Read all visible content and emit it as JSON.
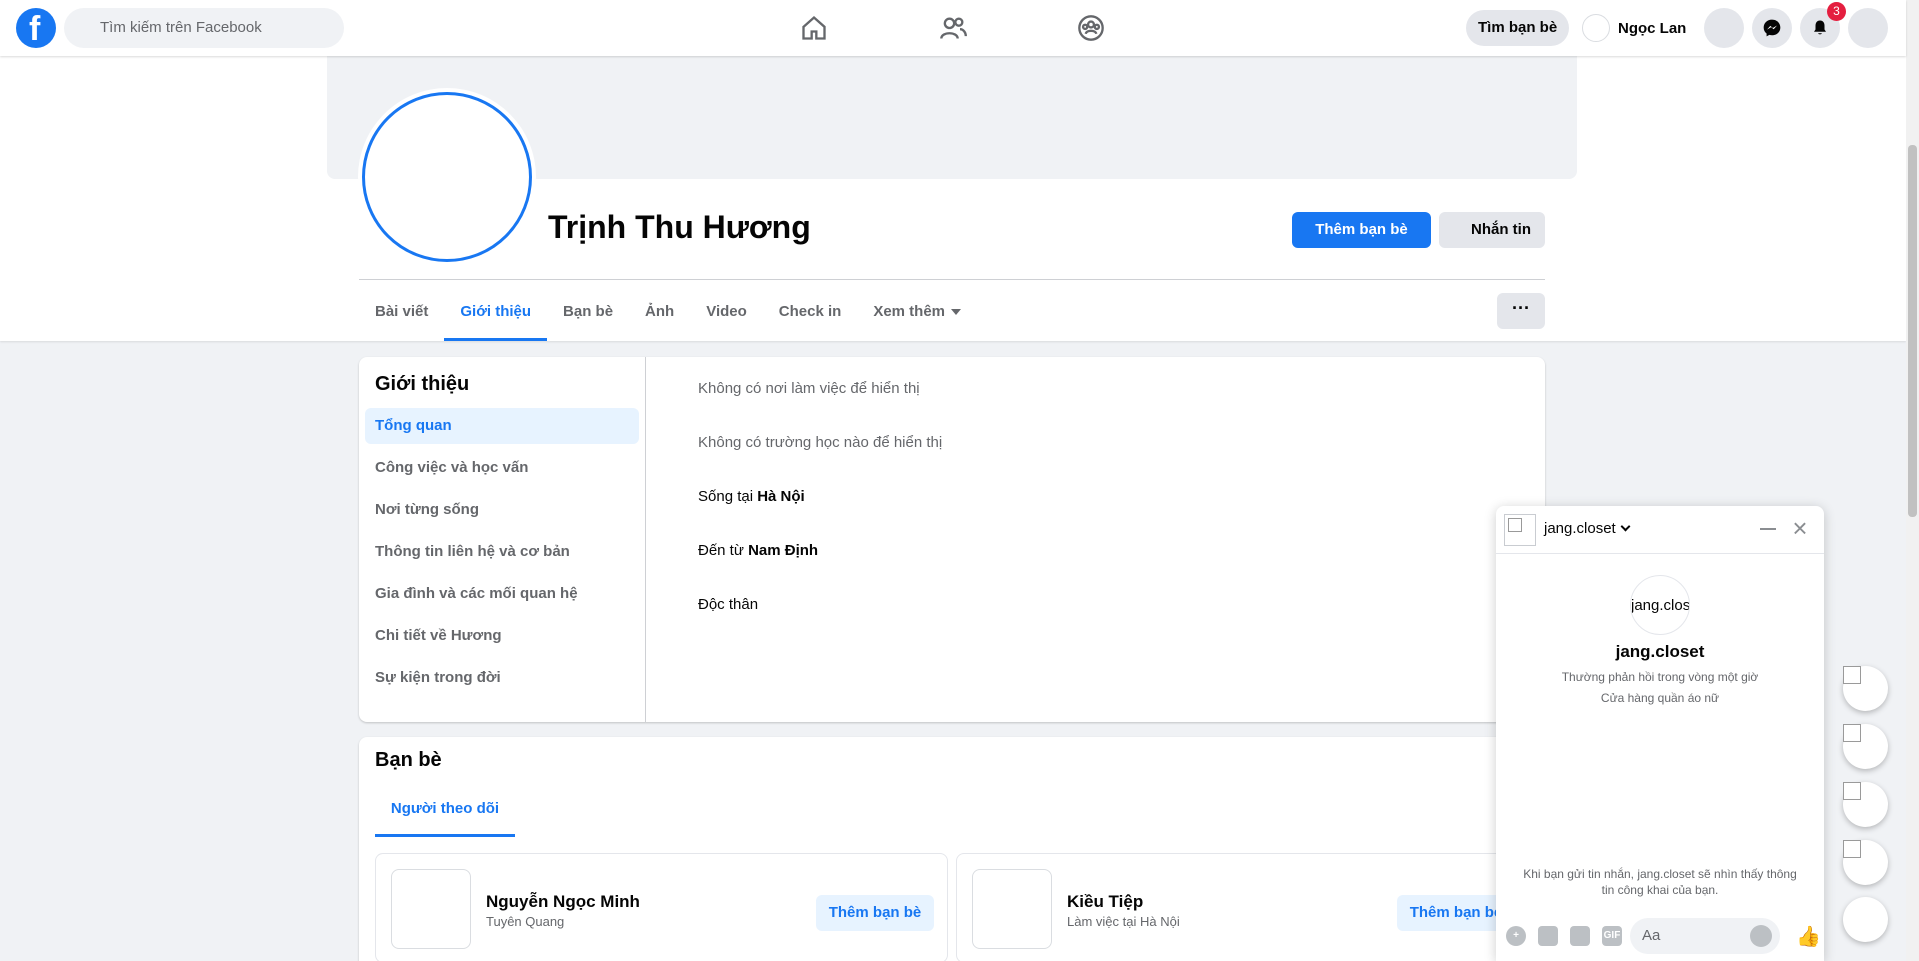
{
  "topbar": {
    "search_placeholder": "Tìm kiếm trên Facebook",
    "find_friends": "Tìm bạn bè",
    "user_name": "Ngọc Lan",
    "notification_count": "3"
  },
  "profile": {
    "name": "Trịnh Thu Hương",
    "add_friend": "Thêm bạn bè",
    "message": "Nhắn tin",
    "more_dots": "···",
    "tabs": [
      "Bài viết",
      "Giới thiệu",
      "Bạn bè",
      "Ảnh",
      "Video",
      "Check in",
      "Xem thêm"
    ]
  },
  "intro": {
    "title": "Giới thiệu",
    "menu": [
      "Tổng quan",
      "Công việc và học vấn",
      "Nơi từng sống",
      "Thông tin liên hệ và cơ bản",
      "Gia đình và các mối quan hệ",
      "Chi tiết về Hương",
      "Sự kiện trong đời"
    ],
    "no_work": "Không có nơi làm việc để hiển thị",
    "no_school": "Không có trường học nào để hiển thị",
    "lives_prefix": "Sống tại ",
    "lives_city": "Hà Nội",
    "from_prefix": "Đến từ ",
    "from_city": "Nam Định",
    "relationship": "Độc thân"
  },
  "friends": {
    "title": "Bạn bè",
    "tab": "Người theo dõi",
    "items": [
      {
        "name": "Nguyễn Ngọc Minh",
        "sub": "Tuyên Quang",
        "button": "Thêm bạn bè"
      },
      {
        "name": "Kiều Tiệp",
        "sub": "Làm việc tại Hà Nội",
        "button": "Thêm bạn bè"
      }
    ]
  },
  "chat": {
    "name": "jang.closet",
    "avatar_alt": "jang.clos",
    "title": "jang.closet",
    "reply_time": "Thường phản hồi trong vòng một giờ",
    "category": "Cửa hàng quần áo nữ",
    "privacy_note": "Khi bạn gửi tin nhắn, jang.closet sẽ nhìn thấy thông tin công khai của bạn.",
    "input_placeholder": "Aa",
    "gif_label": "GIF"
  },
  "colors": {
    "brand": "#1877f2",
    "badge": "#e41e3f"
  }
}
